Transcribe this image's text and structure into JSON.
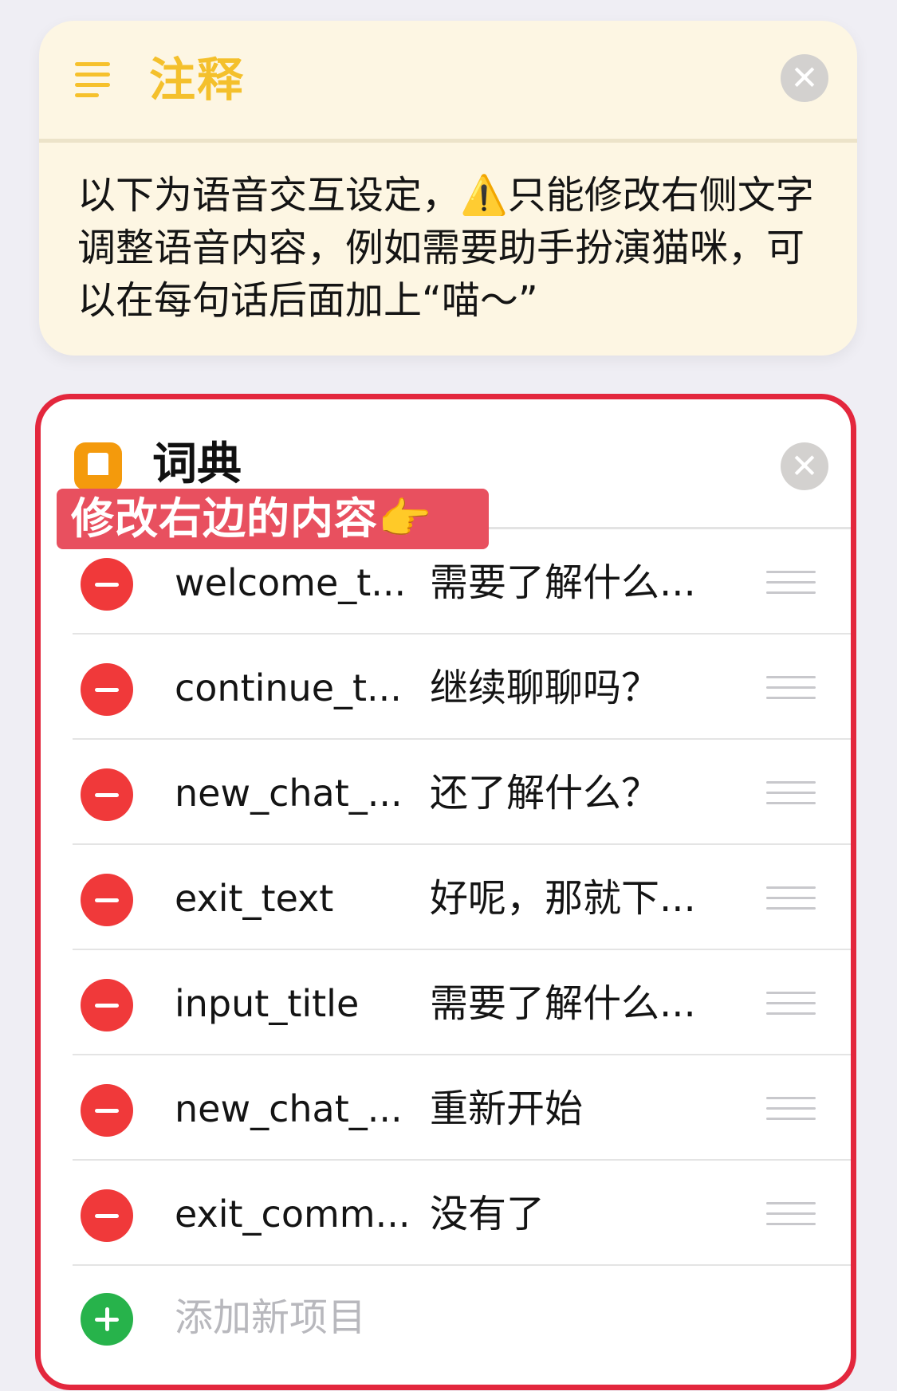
{
  "comment": {
    "title": "注释",
    "close_glyph": "✕",
    "body": "以下为语音交互设定，⚠️只能修改右侧文字调整语音内容，例如需要助手扮演猫咪，可以在每句话后面加上“喵～”"
  },
  "dictionary": {
    "title": "词典",
    "close_glyph": "✕",
    "annotation": "修改右边的内容👉",
    "items": [
      {
        "key": "welcome_t...",
        "value": "需要了解什么..."
      },
      {
        "key": "continue_t...",
        "value": "继续聊聊吗？"
      },
      {
        "key": "new_chat_...",
        "value": "还了解什么？"
      },
      {
        "key": "exit_text",
        "value": "好呢，那就下..."
      },
      {
        "key": "input_title",
        "value": "需要了解什么..."
      },
      {
        "key": "new_chat_...",
        "value": "重新开始"
      },
      {
        "key": "exit_comm...",
        "value": "没有了"
      }
    ],
    "add_label": "添加新项目"
  },
  "colors": {
    "comment_bg": "#fdf6e3",
    "comment_accent": "#f4c02c",
    "annotation_red": "#e3273d",
    "delete_red": "#f0393a",
    "add_green": "#27b34b",
    "dictionary_icon": "#f49a0c"
  },
  "icons": {
    "comment": "text-lines-icon",
    "dictionary": "book-icon",
    "delete": "minus-circle-icon",
    "add": "plus-circle-icon",
    "reorder": "drag-handle-icon",
    "close": "close-circle-icon"
  }
}
